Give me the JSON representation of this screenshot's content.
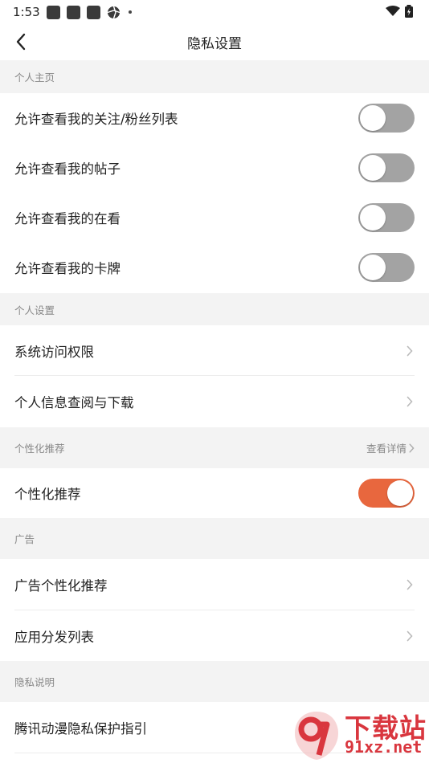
{
  "status_bar": {
    "time": "1:53"
  },
  "header": {
    "title": "隐私设置"
  },
  "sections": {
    "personal_home": {
      "label": "个人主页",
      "items": [
        {
          "label": "允许查看我的关注/粉丝列表",
          "toggle_on": false
        },
        {
          "label": "允许查看我的帖子",
          "toggle_on": false
        },
        {
          "label": "允许查看我的在看",
          "toggle_on": false
        },
        {
          "label": "允许查看我的卡牌",
          "toggle_on": false
        }
      ]
    },
    "personal_settings": {
      "label": "个人设置",
      "items": [
        {
          "label": "系统访问权限"
        },
        {
          "label": "个人信息查阅与下载"
        }
      ]
    },
    "personalized": {
      "label": "个性化推荐",
      "link": "查看详情",
      "items": [
        {
          "label": "个性化推荐",
          "toggle_on": true
        }
      ]
    },
    "ads": {
      "label": "广告",
      "items": [
        {
          "label": "广告个性化推荐"
        },
        {
          "label": "应用分发列表"
        }
      ]
    },
    "privacy_note": {
      "label": "隐私说明",
      "items": [
        {
          "label": "腾讯动漫隐私保护指引"
        }
      ]
    }
  },
  "watermark": {
    "line1": "下载站",
    "line2": "91xz.net"
  },
  "colors": {
    "accent": "#e8673e",
    "toggle_off": "#a3a3a3",
    "section_bg": "#f3f3f3"
  }
}
